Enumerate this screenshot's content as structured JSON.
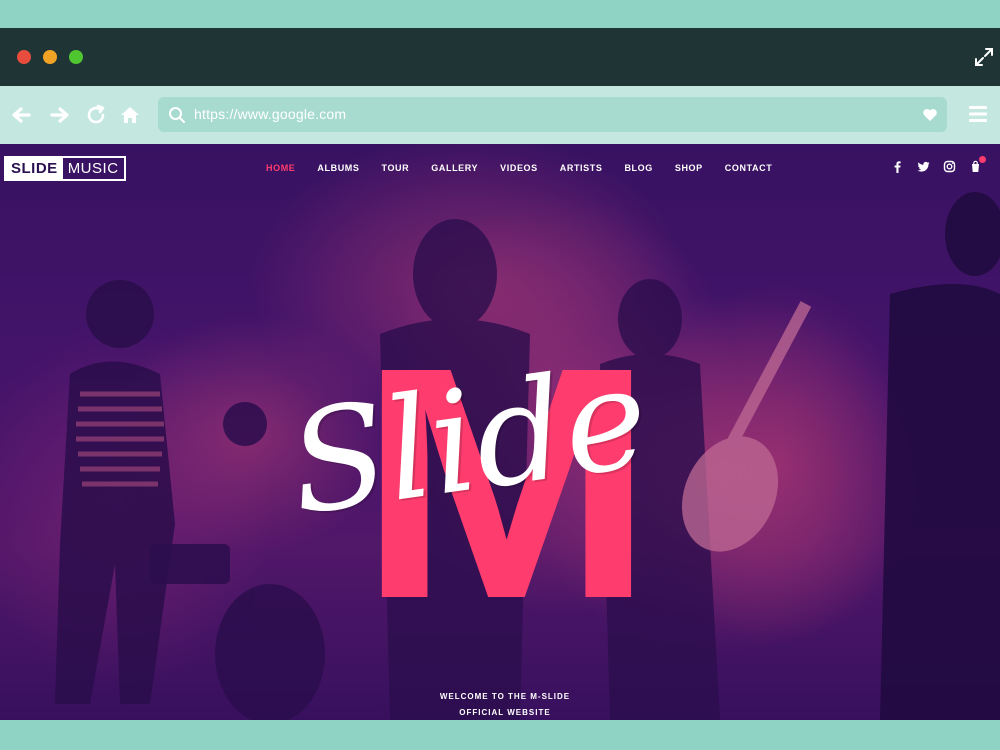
{
  "browser": {
    "url": "https://www.google.com",
    "window_controls": [
      "close",
      "minimize",
      "maximize"
    ],
    "toolbar_icons": [
      "back-arrow-icon",
      "forward-arrow-icon",
      "reload-icon",
      "home-icon"
    ]
  },
  "site": {
    "logo": {
      "part1": "SLIDE",
      "part2": "MUSIC"
    },
    "nav": [
      {
        "label": "HOME",
        "active": true
      },
      {
        "label": "ALBUMS"
      },
      {
        "label": "TOUR"
      },
      {
        "label": "GALLERY"
      },
      {
        "label": "VIDEOS"
      },
      {
        "label": "ARTISTS"
      },
      {
        "label": "BLOG"
      },
      {
        "label": "SHOP"
      },
      {
        "label": "CONTACT"
      }
    ],
    "social": [
      "facebook-icon",
      "twitter-icon",
      "instagram-icon",
      "cart-icon"
    ],
    "hero": {
      "big_letter": "M",
      "script": "Slide",
      "welcome_line1": "WELCOME TO THE M-SLIDE",
      "welcome_line2": "OFFICIAL WEBSITE"
    }
  },
  "colors": {
    "accent": "#ff3c6e",
    "background_purple": "#4a1670",
    "browser_frame": "#1f3535",
    "toolbar": "#c4e7df"
  }
}
